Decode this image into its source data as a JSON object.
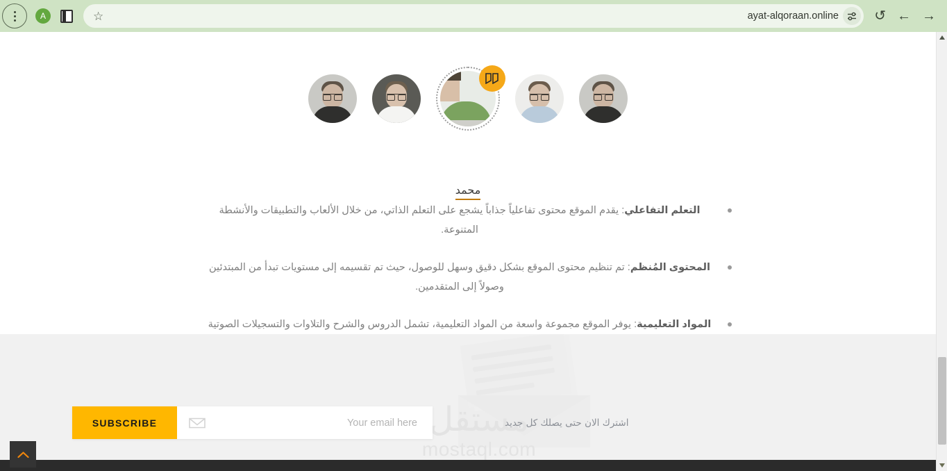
{
  "browser": {
    "menu_icon": "three-dots-vertical-icon",
    "profile_initial": "A",
    "panel_icon": "side-panel-icon",
    "star_icon": "☆",
    "url": "ayat-alqoraan.online",
    "tune_icon": "tune-settings-icon",
    "reload_icon": "↺",
    "back_icon": "←",
    "forward_icon": "→"
  },
  "testimonial": {
    "avatars": [
      {
        "name": "avatar-1",
        "active": false
      },
      {
        "name": "avatar-2",
        "active": false
      },
      {
        "name": "avatar-3",
        "active": true
      },
      {
        "name": "avatar-4",
        "active": false
      },
      {
        "name": "avatar-5",
        "active": false
      }
    ],
    "quote_badge": "””",
    "person_name": "محمد",
    "bullets": [
      {
        "title": "التعلم التفاعلي",
        "body": ": يقدم الموقع محتوى تفاعلياً جذاباً يشجع على التعلم الذاتي، من خلال الألعاب والتطبيقات والأنشطة المتنوعة."
      },
      {
        "title": "المحتوى المُنظم",
        "body": ": تم تنظيم محتوى الموقع بشكل دقيق وسهل للوصول، حيث تم تقسيمه إلى مستويات تبدأ من المبتدئين وصولاً إلى المتقدمين."
      },
      {
        "title": "المواد التعليمية",
        "body": ": يوفر الموقع مجموعة واسعة من المواد التعليمية، تشمل الدروس والشرح والتلاوات والتسجيلات الصوتية والكتب الإلكترونية."
      }
    ]
  },
  "footer": {
    "subscribe_label": "SUBSCRIBE",
    "email_placeholder": "Your email here",
    "email_value": "",
    "envelope_icon": "envelope-icon",
    "note": "اشترك الان حتى يصلك كل جديد",
    "watermark_ar": "مستقل",
    "watermark_en": "mostaql.com"
  },
  "controls": {
    "to_top_icon": "chevron-up-icon",
    "scroll_up_icon": "▲",
    "scroll_down_icon": "▼"
  },
  "colors": {
    "chrome": "#cfe3c4",
    "accent_orange": "#ffb700",
    "badge_orange": "#f5a818",
    "footer_bg": "#f1f1f1",
    "dark_bar": "#2b2b2b"
  }
}
